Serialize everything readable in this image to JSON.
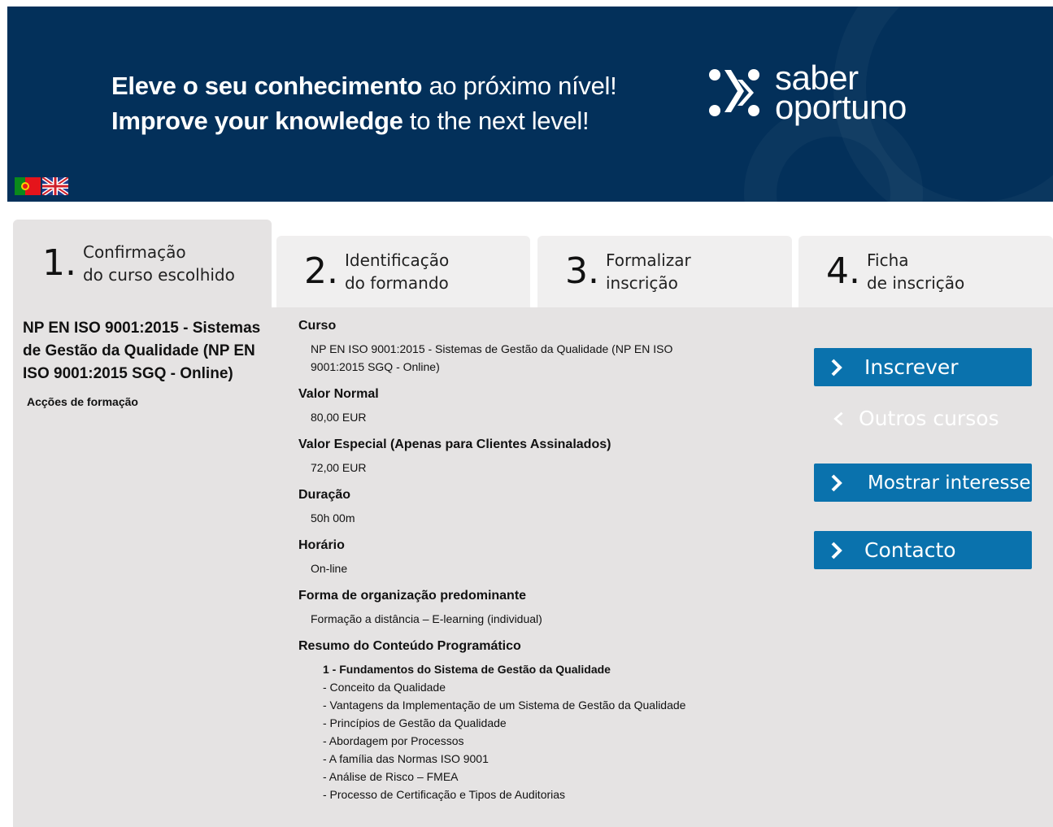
{
  "banner": {
    "line1_bold": "Eleve o seu conhecimento",
    "line1_light": "ao próximo nível!",
    "line2_bold": "Improve your knowledge",
    "line2_light": "to the next level!",
    "logo_line1": "saber",
    "logo_line2": "oportuno",
    "bg_color": "#03305a"
  },
  "flags": [
    "portugal-flag",
    "uk-flag"
  ],
  "steps": [
    {
      "num": "1.",
      "line1": "Confirmação",
      "line2": "do curso escolhido"
    },
    {
      "num": "2.",
      "line1": "Identificação",
      "line2": "do formando"
    },
    {
      "num": "3.",
      "line1": "Formalizar",
      "line2": "inscrição"
    },
    {
      "num": "4.",
      "line1": "Ficha",
      "line2": "de inscrição"
    }
  ],
  "course": {
    "title": "NP EN ISO 9001:2015 - Sistemas de Gestão da Qualidade (NP EN ISO 9001:2015 SGQ - Online)",
    "subtitle": "Acções de formação"
  },
  "fields": {
    "curso_label": "Curso",
    "curso_value": "NP EN ISO 9001:2015 - Sistemas de Gestão da Qualidade (NP EN ISO 9001:2015 SGQ - Online)",
    "valor_label": "Valor Normal",
    "valor_value": "80,00 EUR",
    "especial_label": "Valor Especial (Apenas para Clientes Assinalados)",
    "especial_value": "72,00 EUR",
    "duracao_label": "Duração",
    "duracao_value": "50h 00m",
    "horario_label": "Horário",
    "horario_value": "On-line",
    "forma_label": "Forma de organização predominante",
    "forma_value": "Formação a distância – E-learning (individual)",
    "resumo_label": "Resumo do Conteúdo Programático"
  },
  "programa": {
    "heading": "1 - Fundamentos do Sistema de Gestão da Qualidade",
    "items": [
      "- Conceito da Qualidade",
      "- Vantagens da Implementação de um Sistema de Gestão da Qualidade",
      "- Princípios de Gestão da Qualidade",
      "- Abordagem por Processos",
      "- A família das Normas ISO 9001",
      "- Análise de Risco – FMEA",
      "- Processo de Certificação e Tipos de Auditorias"
    ]
  },
  "actions": {
    "inscrever": "Inscrever",
    "outros": "Outros cursos",
    "interesse": "Mostrar interesse",
    "contacto": "Contacto",
    "button_color": "#0a72ad"
  }
}
